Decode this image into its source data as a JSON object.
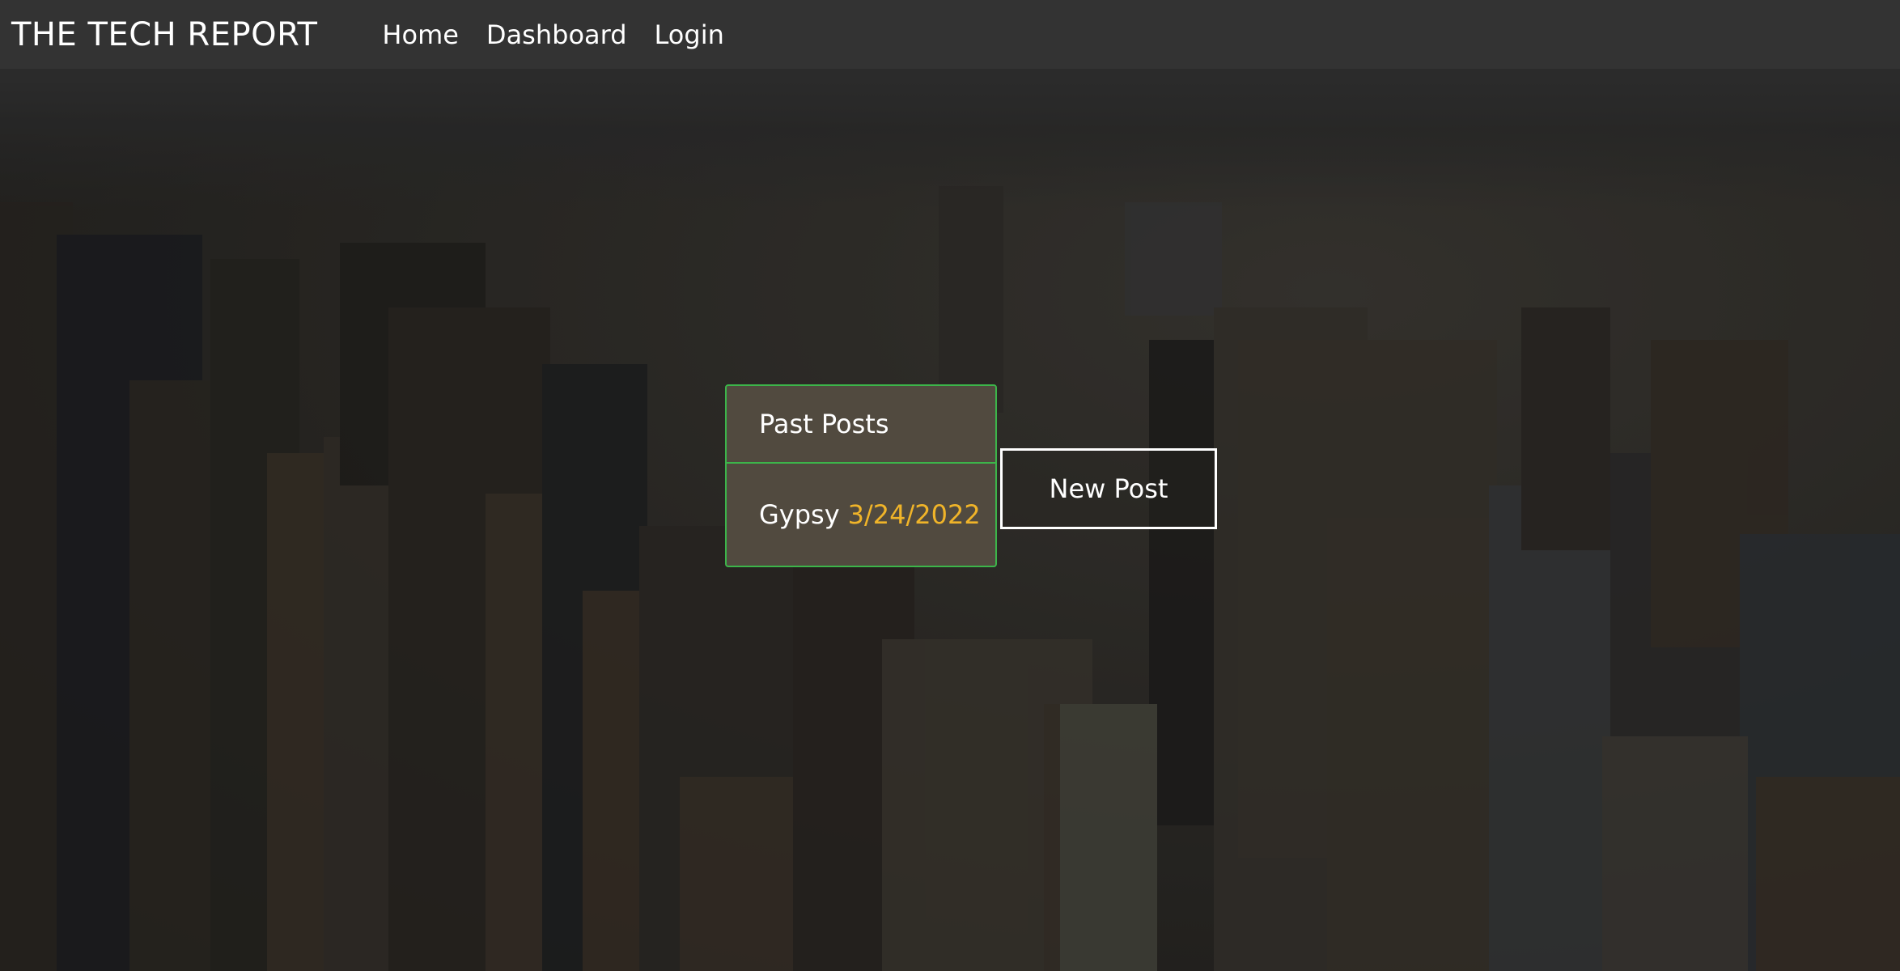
{
  "navbar": {
    "brand": "THE TECH REPORT",
    "links": [
      {
        "label": "Home"
      },
      {
        "label": "Dashboard"
      },
      {
        "label": "Login"
      }
    ]
  },
  "past_posts": {
    "title": "Past Posts",
    "items": [
      {
        "title": "Gypsy",
        "date": "3/24/2022"
      }
    ]
  },
  "new_post_button": {
    "label": "New Post"
  },
  "colors": {
    "navbar_bg": "#333333",
    "panel_bg": "#514a3f",
    "panel_border": "#3cb54a",
    "date_accent": "#f0b429",
    "text": "#ffffff"
  }
}
